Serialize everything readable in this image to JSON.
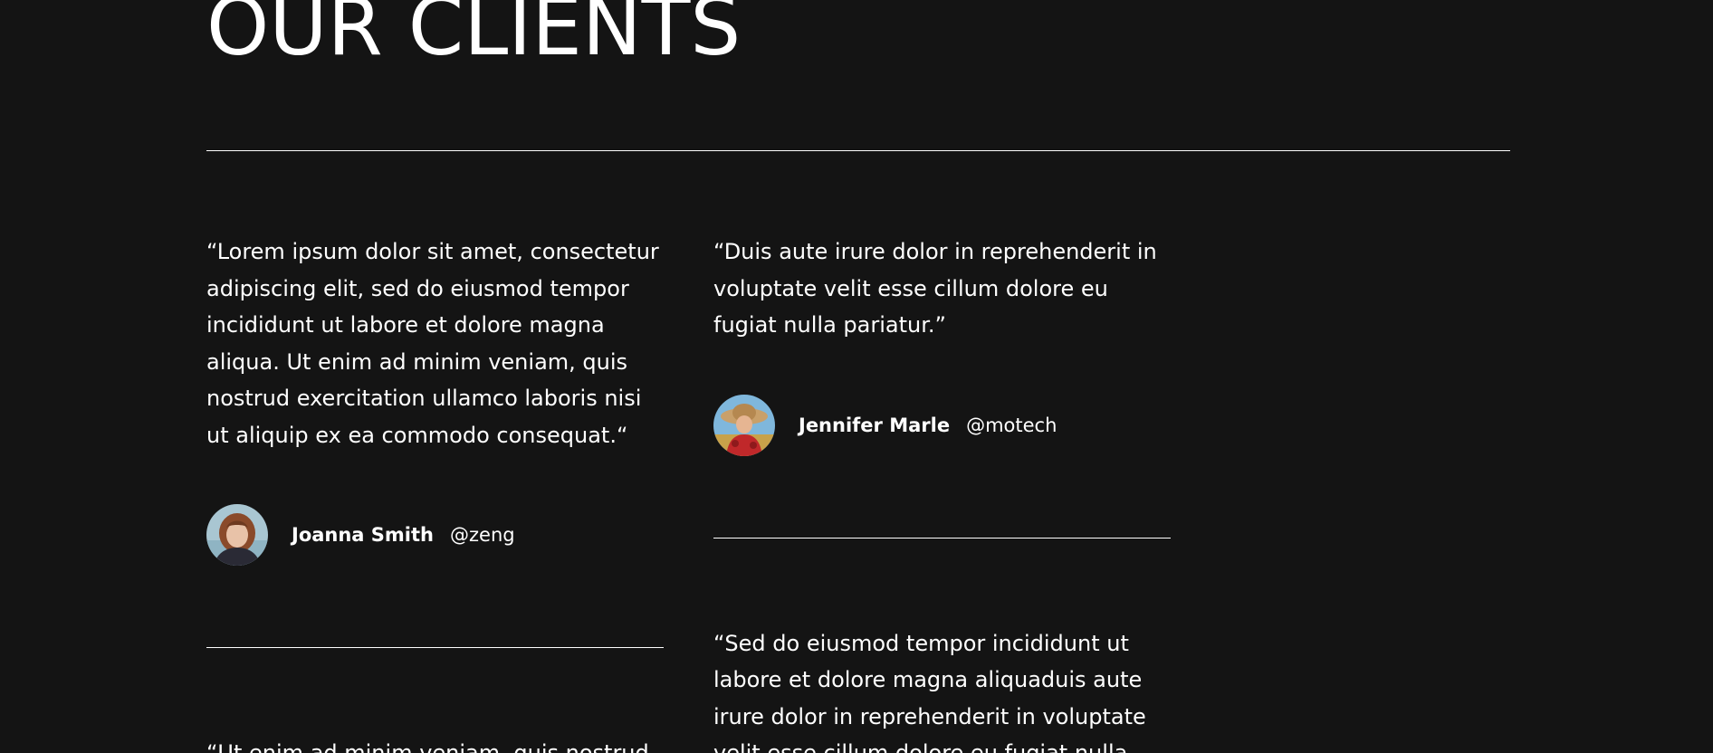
{
  "section": {
    "title": "OUR CLIENTS"
  },
  "testimonials": [
    {
      "quote": "“Lorem ipsum dolor sit amet, consectetur adipiscing elit, sed do eiusmod tempor incididunt ut labore et dolore magna aliqua. Ut enim ad minim veniam, quis nostrud exercitation ullamco laboris nisi ut aliquip ex ea commodo consequat.“",
      "name": "Joanna Smith",
      "handle": "@zeng"
    },
    {
      "quote": "“Duis aute irure dolor in reprehenderit in voluptate velit esse cillum dolore eu fugiat nulla pariatur.”",
      "name": "Jennifer Marle",
      "handle": "@motech"
    },
    {
      "quote": "“Ut enim ad minim veniam, quis nostrud"
    },
    {
      "quote": "“Sed do eiusmod tempor incididunt ut labore et dolore magna aliquaduis aute irure dolor in reprehenderit in voluptate velit esse cillum dolore eu fugiat nulla"
    }
  ],
  "colors": {
    "background": "#141414",
    "text": "#ffffff",
    "rule": "#ffffff"
  },
  "icons": {
    "avatar_1": "avatar-joanna-smith",
    "avatar_2": "avatar-jennifer-marle"
  }
}
